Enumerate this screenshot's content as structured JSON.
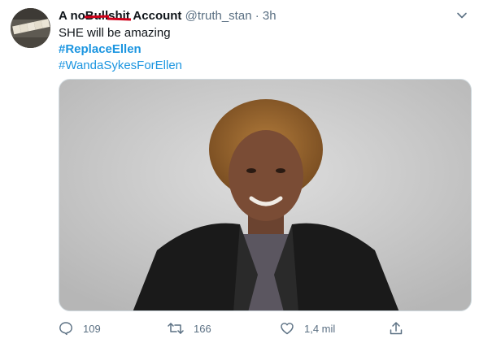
{
  "tweet": {
    "name_parts": [
      "A no",
      "Bull",
      "shit",
      "Account"
    ],
    "handle": "@truth_stan",
    "time": "3h",
    "separator": "·",
    "lines": [
      "SHE will be amazing"
    ],
    "hashtags": [
      "#ReplaceEllen",
      "#WandaSykesForEllen"
    ],
    "avatar_text": "TRUTH"
  },
  "actions": {
    "reply_count": "109",
    "retweet_count": "166",
    "like_count": "1,4 mil"
  },
  "icons": {
    "more": "chevron-down-icon",
    "reply": "reply-icon",
    "retweet": "retweet-icon",
    "like": "heart-icon",
    "share": "share-icon"
  },
  "colors": {
    "hashtag": "#1b95e0",
    "muted": "#5b7083",
    "strike": "#d0021b"
  }
}
